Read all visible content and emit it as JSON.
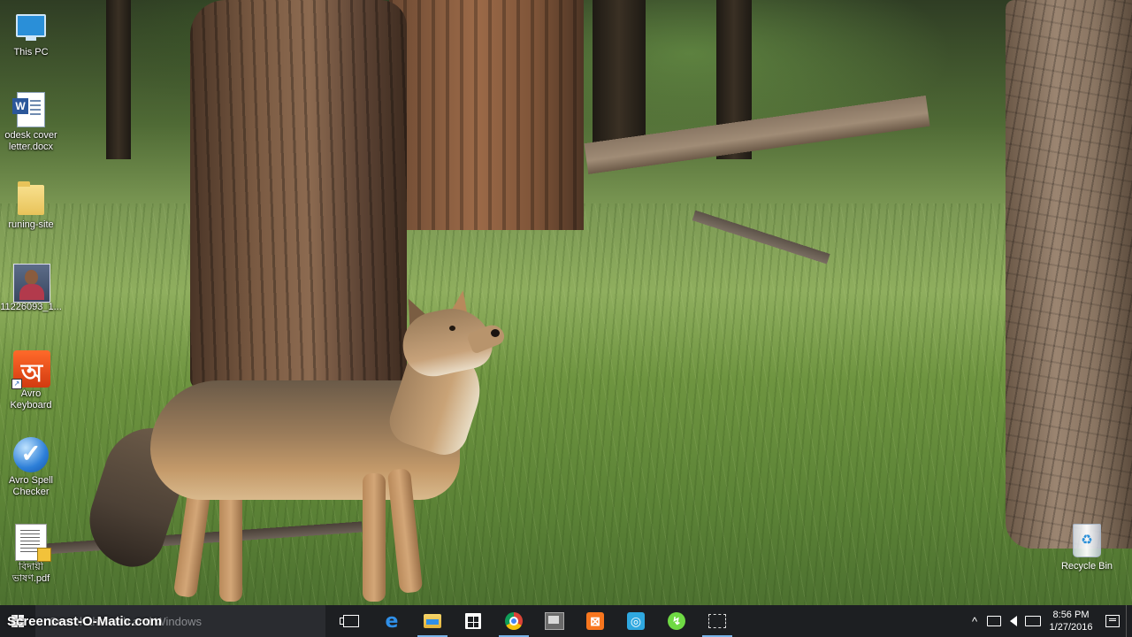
{
  "desktop": {
    "icons": [
      {
        "label": "This PC",
        "icon": "monitor-icon"
      },
      {
        "label": "odesk cover letter.docx",
        "icon": "word-document-icon"
      },
      {
        "label": "runing-site",
        "icon": "folder-icon"
      },
      {
        "label": "11226093_1...",
        "icon": "photo-icon"
      },
      {
        "label": "Avro Keyboard",
        "icon": "avro-keyboard-icon"
      },
      {
        "label": "Avro Spell Checker",
        "icon": "spell-checker-icon"
      },
      {
        "label": "বিদায়ী ভাষণ.pdf",
        "icon": "pdf-icon"
      }
    ],
    "recycle_bin": {
      "label": "Recycle Bin",
      "icon": "recycle-bin-icon"
    }
  },
  "taskbar": {
    "search_placeholder": "Search the web and Windows",
    "watermark": "Screencast-O-Matic.com",
    "pinned": [
      {
        "name": "task-view",
        "icon": "task-view-icon"
      },
      {
        "name": "edge",
        "icon": "edge-icon",
        "glyph": "e"
      },
      {
        "name": "file-explorer",
        "icon": "folder-icon"
      },
      {
        "name": "store",
        "icon": "store-icon"
      },
      {
        "name": "chrome",
        "icon": "chrome-icon"
      },
      {
        "name": "video",
        "icon": "film-icon"
      },
      {
        "name": "xampp",
        "icon": "xampp-icon",
        "glyph": "⊠"
      },
      {
        "name": "camera",
        "icon": "camera-icon",
        "glyph": "◎"
      },
      {
        "name": "upwork",
        "icon": "upwork-icon",
        "glyph": "↯"
      },
      {
        "name": "screen-recorder",
        "icon": "recorder-icon"
      }
    ],
    "tray": {
      "chevron": "^",
      "time": "8:56 PM",
      "date": "1/27/2016"
    }
  }
}
